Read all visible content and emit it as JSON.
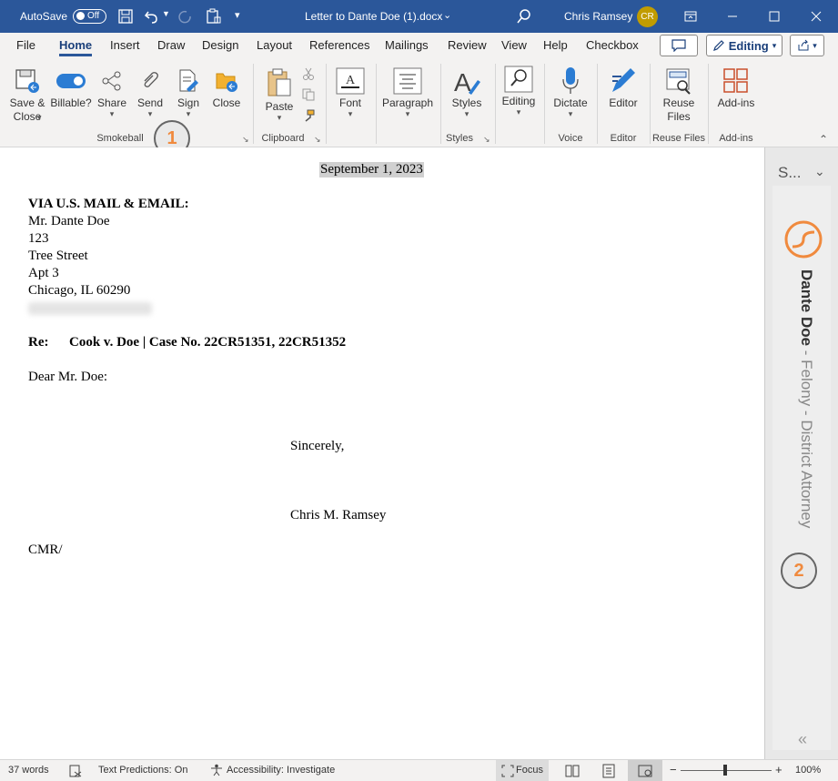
{
  "titlebar": {
    "autosave_label": "AutoSave",
    "autosave_state": "Off",
    "doc_title": "Letter to Dante Doe (1).docx",
    "user_name": "Chris Ramsey",
    "user_initials": "CR"
  },
  "tabs": [
    "File",
    "Home",
    "Insert",
    "Draw",
    "Design",
    "Layout",
    "References",
    "Mailings",
    "Review",
    "View",
    "Help",
    "Checkbox"
  ],
  "editing_button": "Editing",
  "ribbon": {
    "smokeball": {
      "save_close": "Save &\nClose",
      "billable": "Billable?",
      "share": "Share",
      "send": "Send",
      "sign": "Sign",
      "close": "Close",
      "group": "Smokeball"
    },
    "clipboard": {
      "paste": "Paste",
      "group": "Clipboard"
    },
    "font": {
      "label": "Font"
    },
    "paragraph": {
      "label": "Paragraph"
    },
    "styles": {
      "label": "Styles",
      "group": "Styles"
    },
    "editing": {
      "label": "Editing"
    },
    "voice": {
      "dictate": "Dictate",
      "group": "Voice"
    },
    "editor": {
      "label": "Editor",
      "group": "Editor"
    },
    "reuse": {
      "label": "Reuse\nFiles",
      "group": "Reuse Files"
    },
    "addins": {
      "label": "Add-ins",
      "group": "Add-ins"
    }
  },
  "callouts": [
    "1",
    "2"
  ],
  "document": {
    "date": "September 1, 2023",
    "via": "VIA U.S. MAIL & EMAIL:",
    "address": [
      "Mr. Dante Doe",
      "123",
      "Tree Street",
      "Apt 3",
      "Chicago, IL 60290"
    ],
    "re_label": "Re:",
    "re_text": "Cook v. Doe | Case No. 22CR51351, 22CR51352",
    "salutation": "Dear Mr. Doe:",
    "closing": "Sincerely,",
    "signer": "Chris M. Ramsey",
    "initials": "CMR/"
  },
  "sidepanel": {
    "title": "S...",
    "contact": "Dante Doe",
    "matter": " - Felony - District Attorney"
  },
  "status": {
    "words": "37 words",
    "predictions": "Text Predictions: On",
    "accessibility": "Accessibility: Investigate",
    "focus": "Focus",
    "zoom": "100%"
  },
  "colors": {
    "titlebar": "#2b579a",
    "accent_orange": "#f08a3e",
    "date_highlight": "#d0d0d0"
  }
}
